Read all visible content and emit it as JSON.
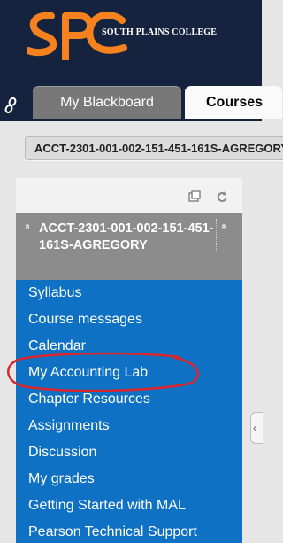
{
  "header": {
    "logo_letters": "SPC",
    "logo_text": "SOUTH PLAINS COLLEGE",
    "brand_color": "#f5821f",
    "background": "#16233f"
  },
  "tabs": [
    {
      "label": "My Blackboard",
      "active": false
    },
    {
      "label": "Courses",
      "active": true
    }
  ],
  "breadcrumb": {
    "course_id": "ACCT-2301-001-002-151-451-161S-AGREGORY"
  },
  "sidebar": {
    "toolbar_icons": [
      "window-icon",
      "refresh-icon"
    ],
    "course_title": "ACCT-2301-001-002-151-451-161S-AGREGORY",
    "caret": "»",
    "menu_items": [
      "Syllabus",
      "Course messages",
      "Calendar",
      "My Accounting Lab",
      "Chapter Resources",
      "Assignments",
      "Discussion",
      "My grades",
      "Getting Started with MAL",
      "Pearson Technical Support"
    ],
    "highlighted_item": "My Accounting Lab",
    "highlight_color": "#d9262d",
    "menu_color": "#0f71c4"
  },
  "scroll_handle": {
    "glyph": "‹"
  }
}
